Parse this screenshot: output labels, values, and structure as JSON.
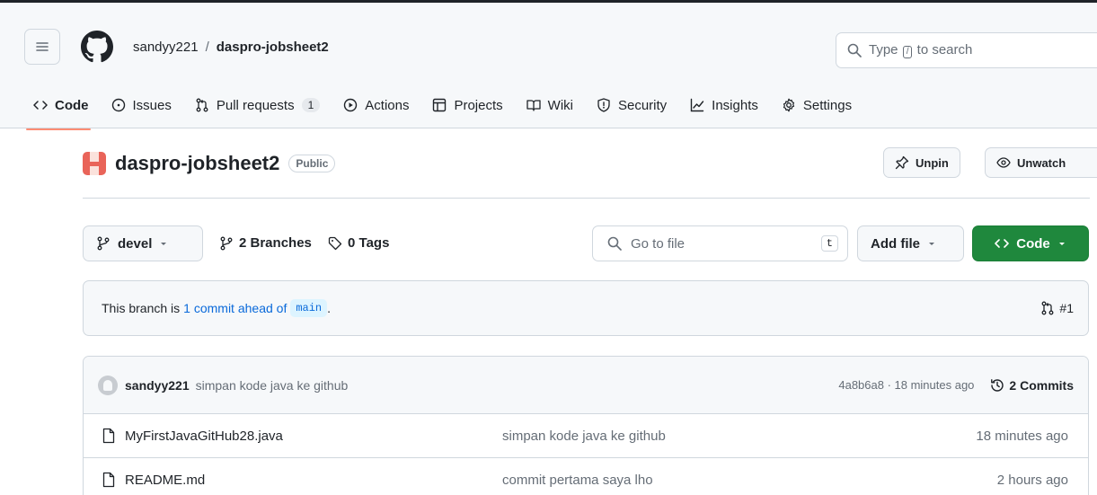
{
  "header": {
    "owner": "sandyy221",
    "separator": "/",
    "repo": "daspro-jobsheet2",
    "search": {
      "prefix": "Type",
      "key": "/",
      "suffix": "to search"
    }
  },
  "tabs": [
    {
      "label": "Code",
      "icon": "code-icon",
      "active": true
    },
    {
      "label": "Issues",
      "icon": "issue-icon"
    },
    {
      "label": "Pull requests",
      "icon": "pull-request-icon",
      "count": "1"
    },
    {
      "label": "Actions",
      "icon": "play-icon"
    },
    {
      "label": "Projects",
      "icon": "table-icon"
    },
    {
      "label": "Wiki",
      "icon": "book-icon"
    },
    {
      "label": "Security",
      "icon": "shield-icon"
    },
    {
      "label": "Insights",
      "icon": "graph-icon"
    },
    {
      "label": "Settings",
      "icon": "gear-icon"
    }
  ],
  "repo_header": {
    "name": "daspro-jobsheet2",
    "visibility": "Public",
    "unpin_label": "Unpin",
    "unwatch_label": "Unwatch"
  },
  "toolbar": {
    "branch": "devel",
    "branches_count": "2",
    "branches_label": "Branches",
    "tags_count": "0",
    "tags_label": "Tags",
    "go_to_file_placeholder": "Go to file",
    "go_to_file_key": "t",
    "add_file_label": "Add file",
    "code_label": "Code"
  },
  "branch_notice": {
    "prefix": "This branch is",
    "link": "1 commit ahead of",
    "base": "main",
    "suffix": ".",
    "pr": "#1"
  },
  "latest_commit": {
    "author": "sandyy221",
    "message": "simpan kode java ke github",
    "hash_time": "4a8b6a8 · 18 minutes ago",
    "commits_label": "2 Commits"
  },
  "files": [
    {
      "name": "MyFirstJavaGitHub28.java",
      "message": "simpan kode java ke github",
      "date": "18 minutes ago"
    },
    {
      "name": "README.md",
      "message": "commit pertama saya lho",
      "date": "2 hours ago"
    }
  ],
  "colors": {
    "accent_green": "#1f883d",
    "link_blue": "#0969da",
    "tab_underline": "#fd8c73"
  }
}
